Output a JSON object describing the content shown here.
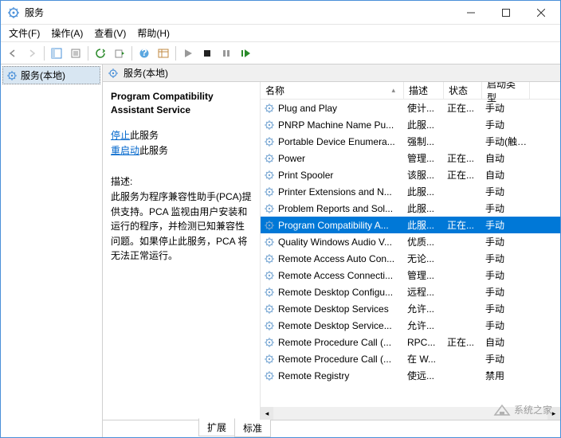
{
  "window": {
    "title": "服务"
  },
  "menu": {
    "file": "文件(F)",
    "action": "操作(A)",
    "view": "查看(V)",
    "help": "帮助(H)"
  },
  "tree": {
    "root": "服务(本地)"
  },
  "tab_title": "服务(本地)",
  "detail": {
    "name": "Program Compatibility Assistant Service",
    "stop_link": "停止",
    "stop_suffix": "此服务",
    "restart_link": "重启动",
    "restart_suffix": "此服务",
    "desc_label": "描述:",
    "desc_text": "此服务为程序兼容性助手(PCA)提供支持。PCA 监视由用户安装和运行的程序，并检测已知兼容性问题。如果停止此服务，PCA 将无法正常运行。"
  },
  "columns": {
    "name": "名称",
    "desc": "描述",
    "status": "状态",
    "startup": "启动类型"
  },
  "services": [
    {
      "name": "Plug and Play",
      "desc": "使计...",
      "status": "正在...",
      "startup": "手动"
    },
    {
      "name": "PNRP Machine Name Pu...",
      "desc": "此服...",
      "status": "",
      "startup": "手动"
    },
    {
      "name": "Portable Device Enumera...",
      "desc": "强制...",
      "status": "",
      "startup": "手动(触发..."
    },
    {
      "name": "Power",
      "desc": "管理...",
      "status": "正在...",
      "startup": "自动"
    },
    {
      "name": "Print Spooler",
      "desc": "该服...",
      "status": "正在...",
      "startup": "自动"
    },
    {
      "name": "Printer Extensions and N...",
      "desc": "此服...",
      "status": "",
      "startup": "手动"
    },
    {
      "name": "Problem Reports and Sol...",
      "desc": "此服...",
      "status": "",
      "startup": "手动"
    },
    {
      "name": "Program Compatibility A...",
      "desc": "此服...",
      "status": "正在...",
      "startup": "手动",
      "selected": true
    },
    {
      "name": "Quality Windows Audio V...",
      "desc": "优质...",
      "status": "",
      "startup": "手动"
    },
    {
      "name": "Remote Access Auto Con...",
      "desc": "无论...",
      "status": "",
      "startup": "手动"
    },
    {
      "name": "Remote Access Connecti...",
      "desc": "管理...",
      "status": "",
      "startup": "手动"
    },
    {
      "name": "Remote Desktop Configu...",
      "desc": "远程...",
      "status": "",
      "startup": "手动"
    },
    {
      "name": "Remote Desktop Services",
      "desc": "允许...",
      "status": "",
      "startup": "手动"
    },
    {
      "name": "Remote Desktop Service...",
      "desc": "允许...",
      "status": "",
      "startup": "手动"
    },
    {
      "name": "Remote Procedure Call (...",
      "desc": "RPC...",
      "status": "正在...",
      "startup": "自动"
    },
    {
      "name": "Remote Procedure Call (...",
      "desc": "在 W...",
      "status": "",
      "startup": "手动"
    },
    {
      "name": "Remote Registry",
      "desc": "使远...",
      "status": "",
      "startup": "禁用"
    }
  ],
  "tabs": {
    "extended": "扩展",
    "standard": "标准"
  },
  "watermark": "系统之家"
}
